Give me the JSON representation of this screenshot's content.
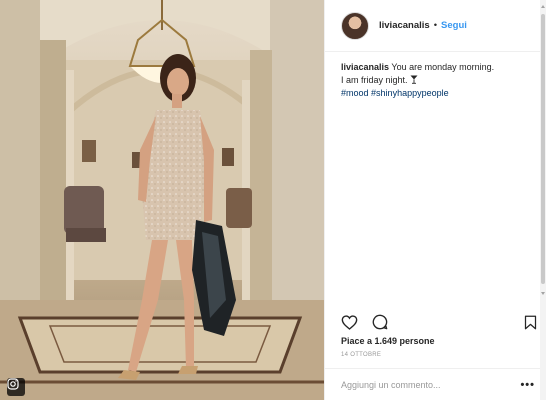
{
  "post": {
    "username": "liviacanalis",
    "dot": "•",
    "follow_label": "Segui",
    "caption_user": "liviacanalis",
    "caption_line1": "You are monday morning.",
    "caption_line2": "I am friday night.",
    "hashtags": [
      "#mood",
      "#shinyhappypeople"
    ],
    "likes_text": "Piace a 1.649 persone",
    "date_text": "14 OTTOBRE",
    "comment_placeholder": "Aggiungi un commento...",
    "more_label": "•••"
  },
  "icons": {
    "heart": "heart-icon",
    "comment": "comment-icon",
    "save": "bookmark-icon",
    "media_badge": "instagram-badge-icon",
    "emoji": "cocktail-glass-icon"
  },
  "colors": {
    "link_blue": "#3897f0",
    "hashtag": "#003569",
    "text": "#262626",
    "muted": "#999999",
    "border": "#efefef"
  }
}
